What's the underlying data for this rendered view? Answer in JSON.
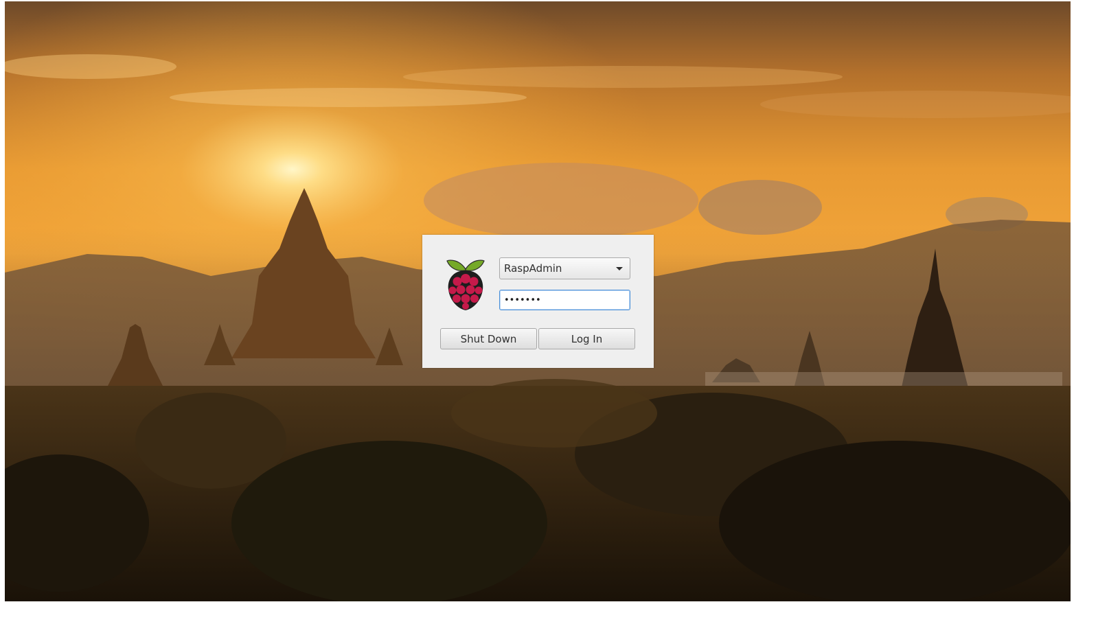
{
  "login": {
    "selected_user": "RaspAdmin",
    "password_mask": "•••••••",
    "shutdown_label": "Shut Down",
    "login_label": "Log In"
  },
  "icons": {
    "logo": "raspberry-pi-logo",
    "dropdown": "chevron-down-icon"
  },
  "colors": {
    "focus_border": "#4a90d9",
    "panel_bg": "#efefef",
    "raspberry": "#c51a4a",
    "leaf": "#75a928"
  }
}
